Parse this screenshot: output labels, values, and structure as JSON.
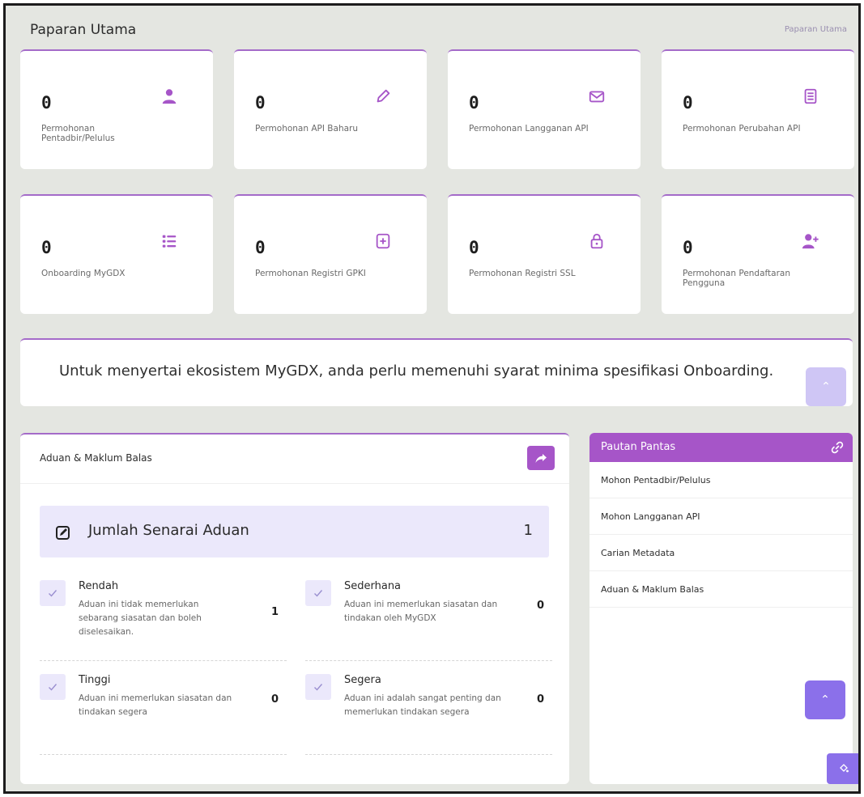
{
  "header": {
    "title": "Paparan Utama",
    "breadcrumb": "Paparan Utama"
  },
  "stats": [
    {
      "count": "0",
      "label": "Permohonan Pentadbir/Pelulus",
      "icon": "user-icon"
    },
    {
      "count": "0",
      "label": "Permohonan API Baharu",
      "icon": "pencil-icon"
    },
    {
      "count": "0",
      "label": "Permohonan Langganan API",
      "icon": "mail-icon"
    },
    {
      "count": "0",
      "label": "Permohonan Perubahan API",
      "icon": "document-icon"
    },
    {
      "count": "0",
      "label": "Onboarding MyGDX",
      "icon": "list-icon"
    },
    {
      "count": "0",
      "label": "Permohonan Registri GPKI",
      "icon": "file-plus-icon"
    },
    {
      "count": "0",
      "label": "Permohonan Registri SSL",
      "icon": "lock-icon"
    },
    {
      "count": "0",
      "label": "Permohonan Pendaftaran Pengguna",
      "icon": "user-plus-icon"
    }
  ],
  "banner": {
    "text": "Untuk menyertai ekosistem MyGDX, anda perlu memenuhi syarat minima spesifikasi Onboarding."
  },
  "complaints": {
    "title": "Aduan & Maklum Balas",
    "total_label": "Jumlah Senarai Aduan",
    "total_count": "1",
    "categories": [
      {
        "name": "Rendah",
        "desc": "Aduan ini tidak memerlukan sebarang siasatan dan boleh diselesaikan.",
        "count": "1"
      },
      {
        "name": "Sederhana",
        "desc": "Aduan ini memerlukan siasatan dan tindakan oleh MyGDX",
        "count": "0"
      },
      {
        "name": "Tinggi",
        "desc": "Aduan ini memerlukan siasatan dan tindakan segera",
        "count": "0"
      },
      {
        "name": "Segera",
        "desc": "Aduan ini adalah sangat penting dan memerlukan tindakan segera",
        "count": "0"
      }
    ]
  },
  "quick_links": {
    "title": "Pautan Pantas",
    "items": [
      "Mohon Pentadbir/Pelulus",
      "Mohon Langganan API",
      "Carian Metadata",
      "Aduan & Maklum Balas"
    ]
  },
  "colors": {
    "accent": "#a655c8",
    "button": "#8b70ea",
    "background": "#e4e6e1"
  }
}
